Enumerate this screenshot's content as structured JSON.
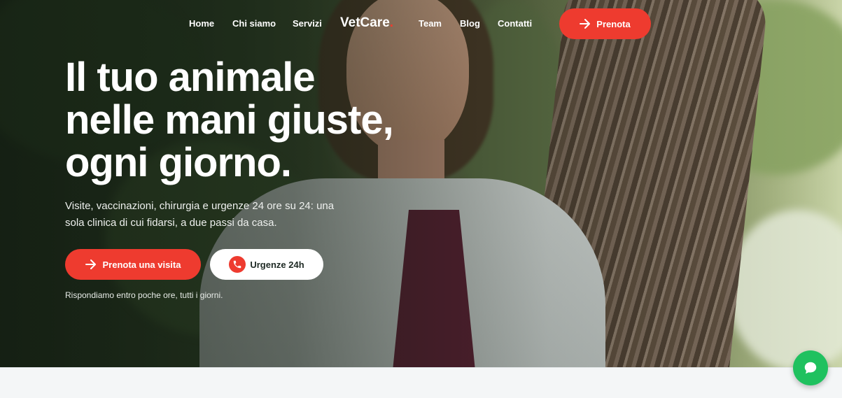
{
  "nav": {
    "links": [
      "Home",
      "Chi siamo",
      "Servizi",
      "Team",
      "Blog",
      "Contatti"
    ],
    "brand": "VetCare",
    "brand_dot": ".",
    "cta_label": "Prenota"
  },
  "hero": {
    "headline_line1": "Il tuo animale",
    "headline_line2": "nelle mani giuste,",
    "headline_line3": "ogni giorno.",
    "subtitle": "Visite, vaccinazioni, chirurgia e urgenze 24 ore su 24: una sola clinica di cui fidarsi, a due passi da casa.",
    "primary_button": "Prenota una visita",
    "secondary_button": "Urgenze 24h",
    "note": "Rispondiamo entro poche ore, tutti i giorni."
  },
  "colors": {
    "accent": "#ee3b2f",
    "chat": "#1fc15f"
  },
  "icons": {
    "arrow": "arrow-right-icon",
    "phone": "phone-icon",
    "chat": "chat-bubble-icon"
  }
}
